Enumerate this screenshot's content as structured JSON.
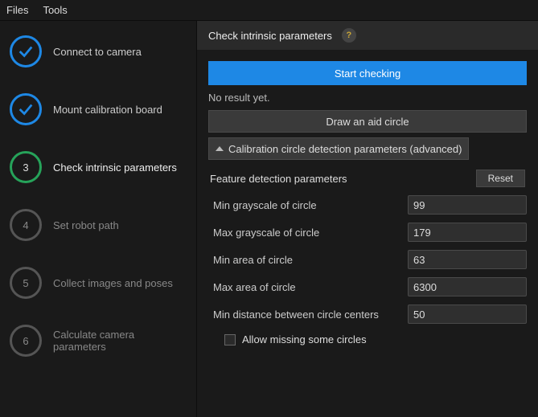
{
  "menu": {
    "files": "Files",
    "tools": "Tools"
  },
  "steps": [
    {
      "label": "Connect to camera",
      "state": "done",
      "num": ""
    },
    {
      "label": "Mount calibration board",
      "state": "done",
      "num": ""
    },
    {
      "label": "Check intrinsic parameters",
      "state": "active",
      "num": "3"
    },
    {
      "label": "Set robot path",
      "state": "todo",
      "num": "4"
    },
    {
      "label": "Collect images and poses",
      "state": "todo",
      "num": "5"
    },
    {
      "label": "Calculate camera parameters",
      "state": "todo",
      "num": "6"
    }
  ],
  "panel": {
    "title": "Check intrinsic parameters",
    "help_glyph": "?",
    "start_btn": "Start checking",
    "status": "No result yet.",
    "aid_btn": "Draw an aid circle",
    "accordion": "Calibration circle detection parameters (advanced)",
    "params_heading": "Feature detection parameters",
    "reset": "Reset",
    "params": {
      "min_gray": {
        "label": "Min grayscale of circle",
        "value": "99"
      },
      "max_gray": {
        "label": "Max grayscale of circle",
        "value": "179"
      },
      "min_area": {
        "label": "Min area of circle",
        "value": "63"
      },
      "max_area": {
        "label": "Max area of circle",
        "value": "6300"
      },
      "min_dist": {
        "label": "Min distance between circle centers",
        "value": "50"
      }
    },
    "allow_missing": "Allow missing some circles"
  },
  "colors": {
    "accent_blue": "#1e88e5",
    "accent_green": "#26a35a"
  }
}
